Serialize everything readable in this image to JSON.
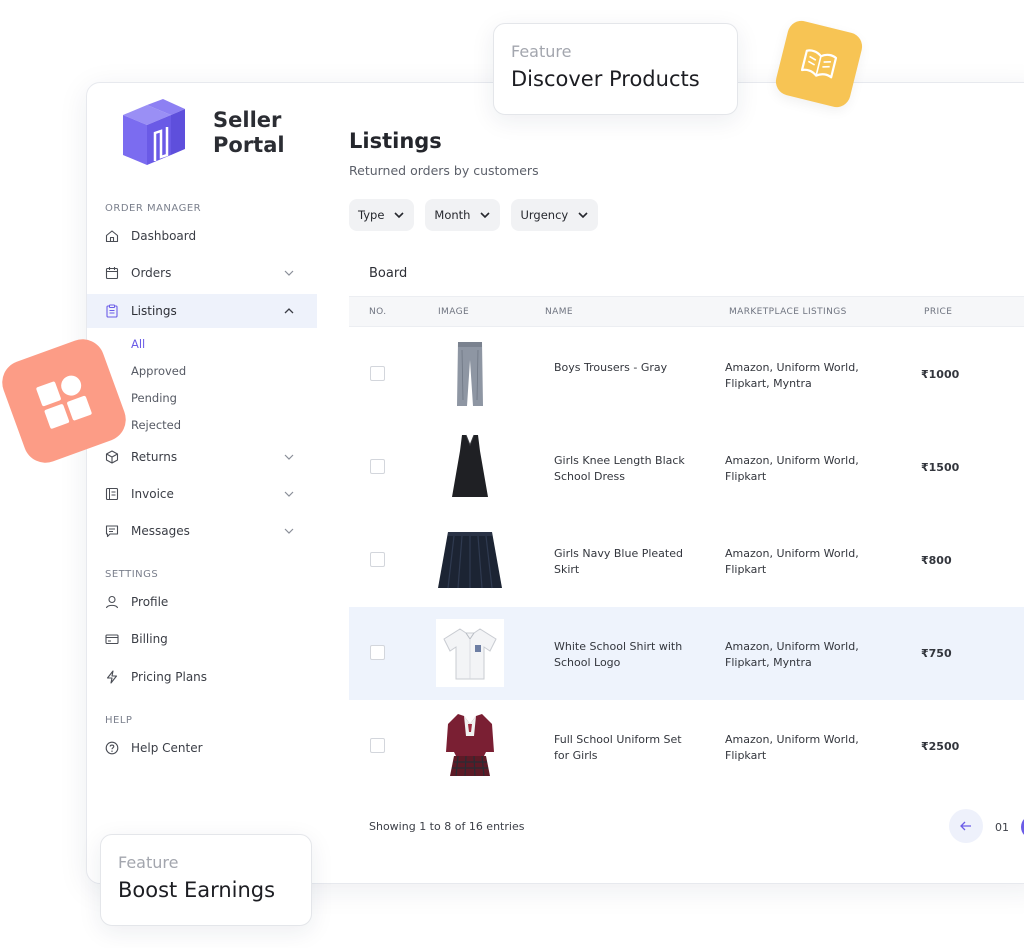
{
  "sidebar": {
    "brand": "Seller Portal",
    "sections": {
      "order_manager": "ORDER MANAGER",
      "settings": "SETTINGS",
      "help": "HELP"
    },
    "items": {
      "dashboard": "Dashboard",
      "orders": "Orders",
      "listings": "Listings",
      "returns": "Returns",
      "invoice": "Invoice",
      "messages": "Messages",
      "profile": "Profile",
      "billing": "Billing",
      "pricing_plans": "Pricing Plans",
      "help_center": "Help Center"
    },
    "listing_subitems": [
      "All",
      "Approved",
      "Pending",
      "Rejected"
    ]
  },
  "main": {
    "title": "Listings",
    "subtitle": "Returned orders by customers",
    "filters": [
      "Type",
      "Month",
      "Urgency"
    ],
    "board_label": "Board",
    "columns": [
      "NO.",
      "IMAGE",
      "NAME",
      "MARKETPLACE LISTINGS",
      "PRICE"
    ],
    "rows": [
      {
        "name": "Boys Trousers - Gray",
        "marketplaces": "Amazon, Uniform World, Flipkart, Myntra",
        "price": "₹1000",
        "image": "trousers-image"
      },
      {
        "name": "Girls Knee Length Black School Dress",
        "marketplaces": "Amazon, Uniform World, Flipkart",
        "price": "₹1500",
        "image": "dress-image"
      },
      {
        "name": "Girls Navy Blue Pleated Skirt",
        "marketplaces": "Amazon, Uniform World, Flipkart",
        "price": "₹800",
        "image": "skirt-image"
      },
      {
        "name": "White School Shirt with School Logo",
        "marketplaces": "Amazon, Uniform World, Flipkart, Myntra",
        "price": "₹750",
        "image": "shirt-image"
      },
      {
        "name": "Full School Uniform Set for Girls",
        "marketplaces": "Amazon, Uniform World, Flipkart",
        "price": "₹2500",
        "image": "uniform-image"
      }
    ],
    "showing": "Showing 1 to 8 of 16 entries",
    "page": "01"
  },
  "features": [
    {
      "label": "Feature",
      "title": "Discover Products"
    },
    {
      "label": "Feature",
      "title": "Boost Earnings"
    }
  ],
  "colors": {
    "accent": "#6b5ce7",
    "logo": "#7b6cf0",
    "highlight_row": "#eef3fc",
    "yellow_badge": "#f7c454",
    "pink_badge": "#fc9c86"
  },
  "icons": {
    "yellow_badge": "book-open-icon",
    "pink_badge": "grid-shapes-icon"
  }
}
